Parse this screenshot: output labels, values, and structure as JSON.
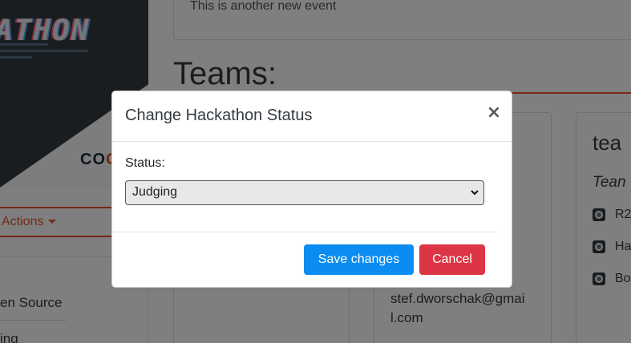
{
  "banner": {
    "title": "ATHON",
    "brand_prefix": "CO",
    "brand_o": "O"
  },
  "sidebar": {
    "actions_label": "Actions",
    "items": [
      {
        "label": "en Source"
      },
      {
        "label": "ing"
      }
    ]
  },
  "event": {
    "text": "This is another new event"
  },
  "teams": {
    "heading": "Teams:",
    "card_fragments": {
      "label_suffix": "s:",
      "email_line1": "stef.dworschak@gmai",
      "email_line2": "l.com",
      "card2_title": "tea",
      "card2_subtitle": "Tean",
      "repo_items": [
        "R2",
        "Ha",
        "Bo"
      ]
    }
  },
  "modal": {
    "title": "Change Hackathon Status",
    "close_symbol": "×",
    "status_label": "Status:",
    "status_value": "Judging",
    "save_label": "Save changes",
    "cancel_label": "Cancel"
  },
  "colors": {
    "accent": "#e9552a",
    "primary_button": "#0a8cf0",
    "danger_button": "#dc3545"
  }
}
